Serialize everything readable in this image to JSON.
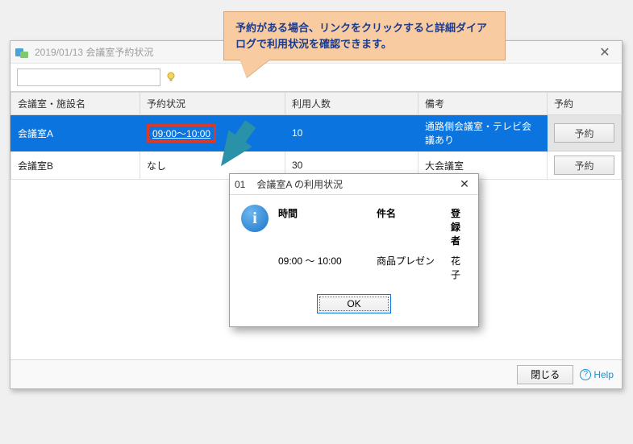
{
  "window": {
    "title": "2019/01/13 会議室予約状況"
  },
  "callout": {
    "text": "予約がある場合、リンクをクリックすると詳細ダイアログで利用状況を確認できます。"
  },
  "search": {
    "value": ""
  },
  "grid": {
    "headers": {
      "room": "会議室・施設名",
      "status": "予約状況",
      "capacity": "利用人数",
      "note": "備考",
      "reserve": "予約"
    },
    "rows": [
      {
        "room": "会議室A",
        "status": "09:00～10:00",
        "capacity": "10",
        "note": "通路側会議室・テレビ会議あり",
        "reserve": "予約",
        "has_link": true,
        "selected": true
      },
      {
        "room": "会議室B",
        "status": "なし",
        "capacity": "30",
        "note": "大会議室",
        "reserve": "予約",
        "has_link": false,
        "selected": false
      }
    ]
  },
  "dialog": {
    "title_prefix": "01",
    "title": "会議室A の利用状況",
    "headers": {
      "time": "時間",
      "subject": "件名",
      "registrant": "登録者"
    },
    "values": {
      "time": "09:00 ～ 10:00",
      "subject": "商品プレゼン",
      "registrant": "花子"
    },
    "ok": "OK"
  },
  "footer": {
    "close": "閉じる",
    "help": "Help"
  }
}
